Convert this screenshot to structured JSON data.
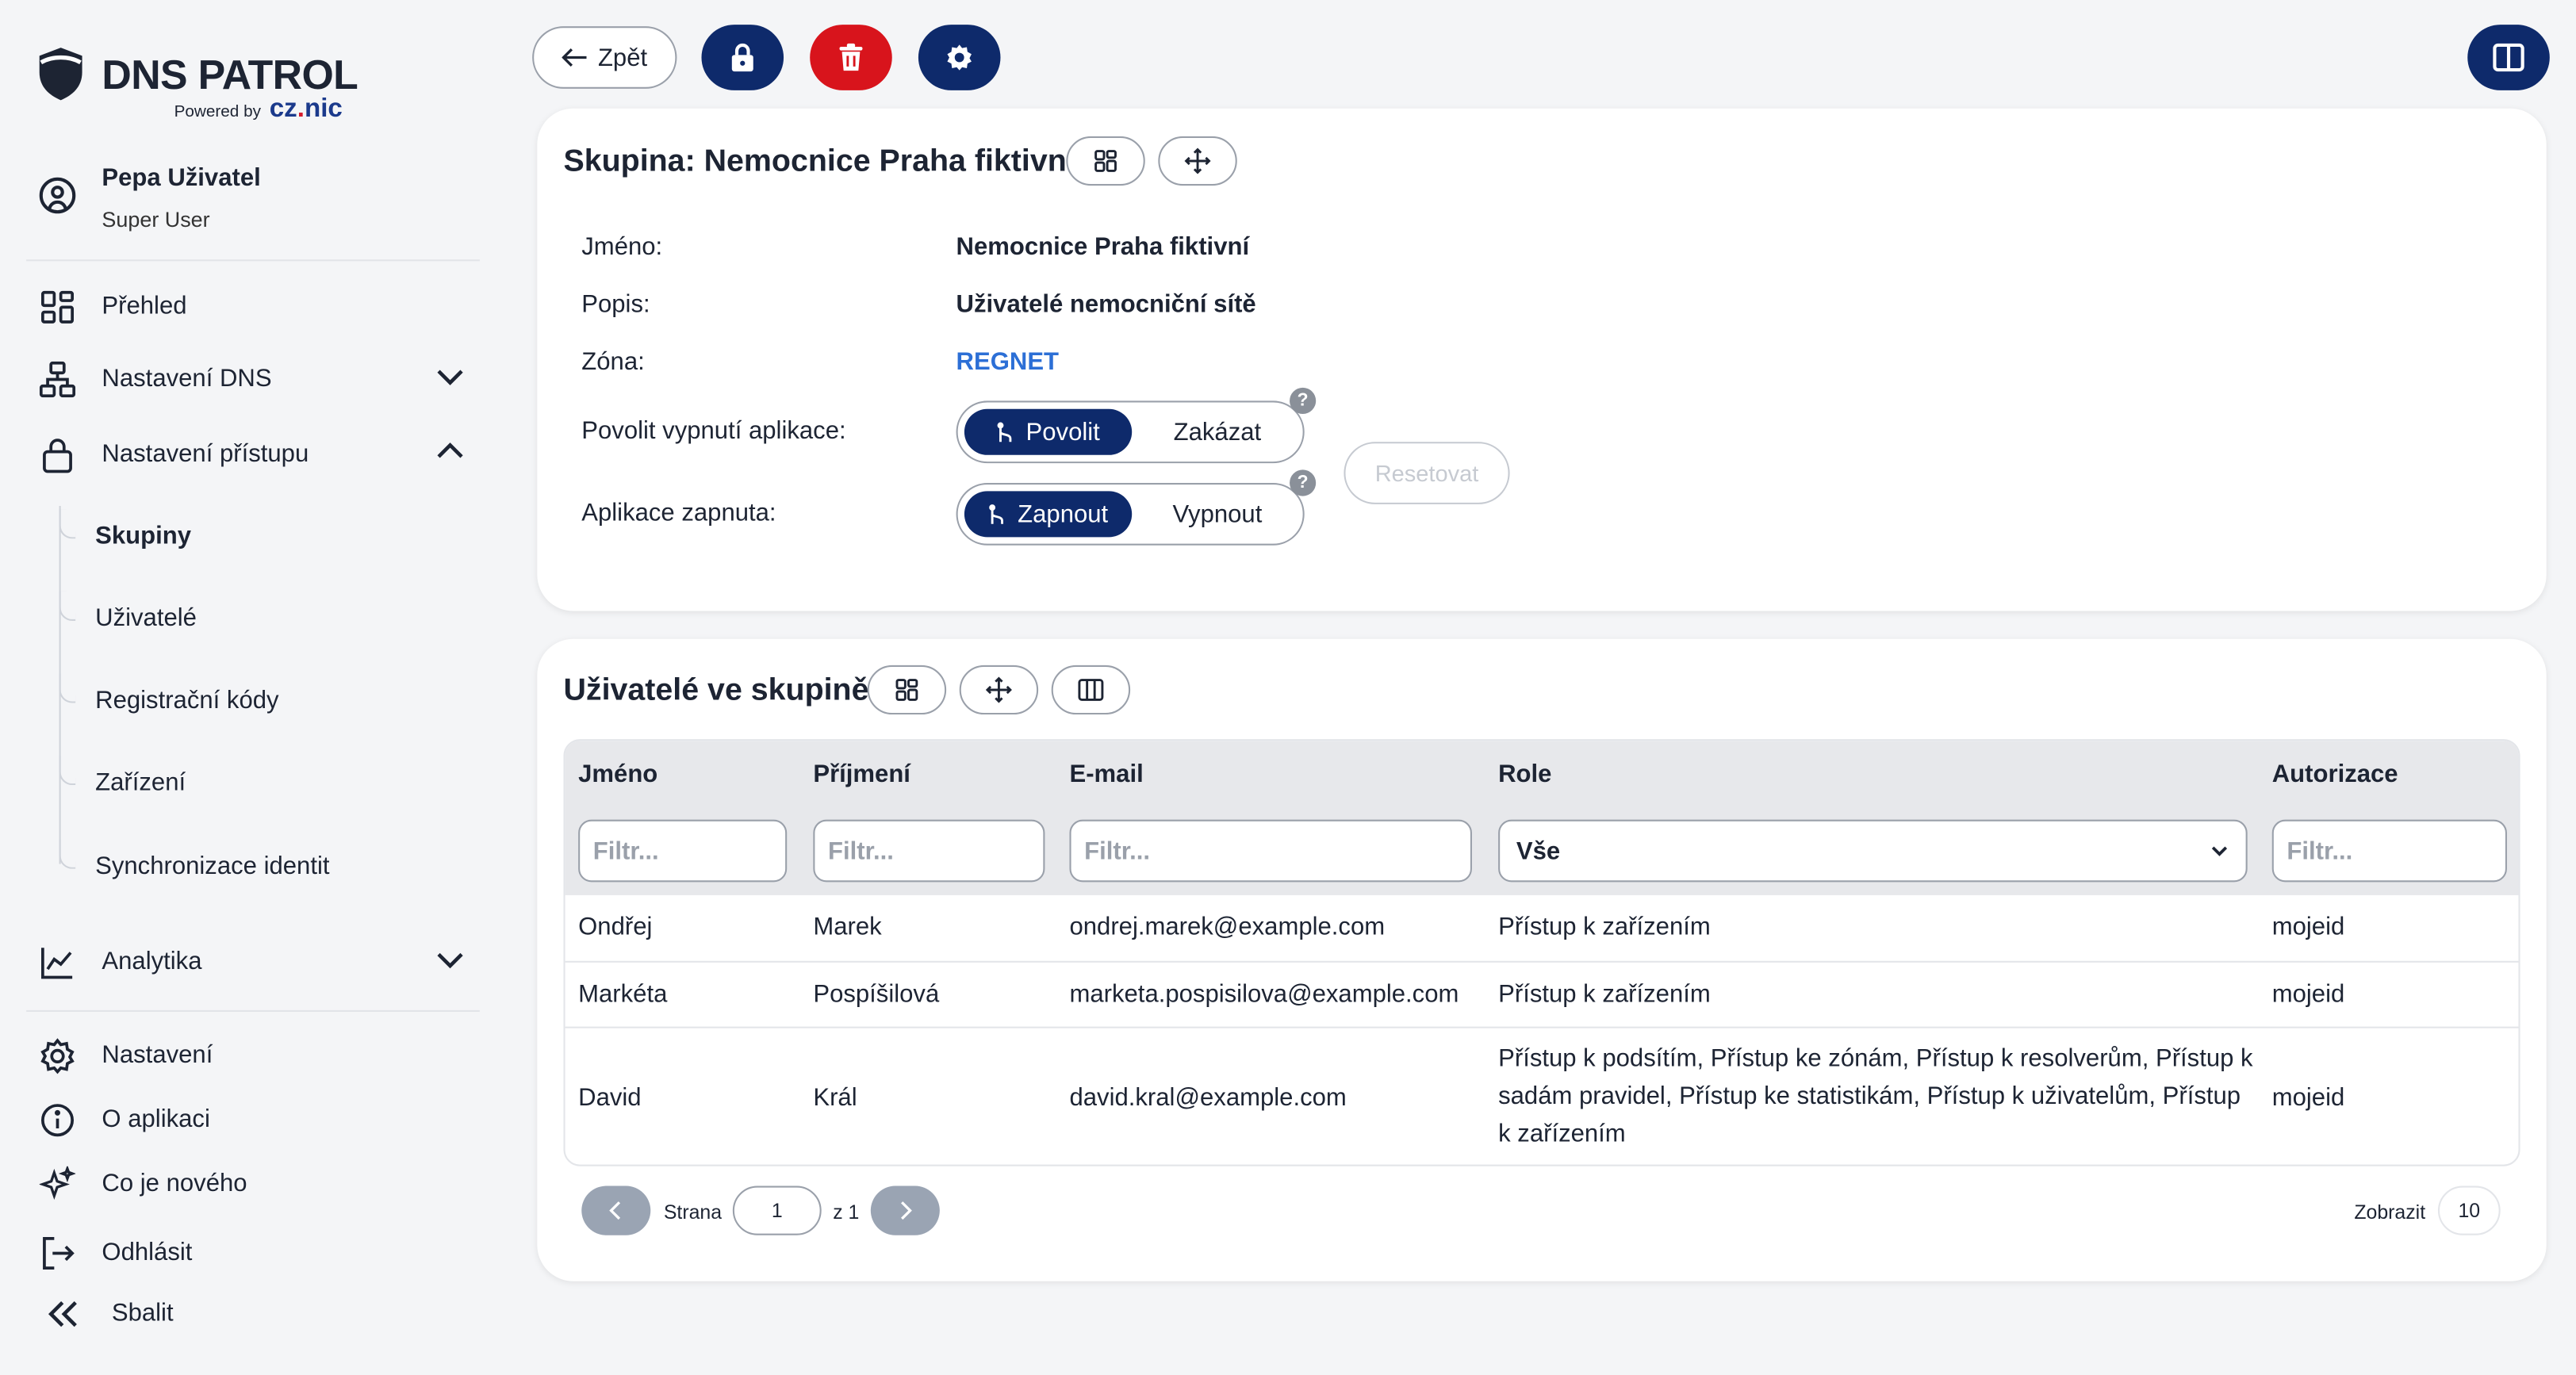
{
  "brand": {
    "name": "DNS PATROL",
    "powered_by": "Powered by",
    "partner": "cz",
    "partner_dot": ".",
    "partner_tail": "nic"
  },
  "user": {
    "name": "Pepa Uživatel",
    "role": "Super User"
  },
  "nav": {
    "overview": "Přehled",
    "dns_settings": "Nastavení DNS",
    "access_settings": "Nastavení přístupu",
    "sub": [
      "Skupiny",
      "Uživatelé",
      "Registrační kódy",
      "Zařízení",
      "Synchronizace identit"
    ],
    "analytics": "Analytika",
    "settings": "Nastavení",
    "about": "O aplikaci",
    "whats_new": "Co je nového",
    "logout": "Odhlásit",
    "collapse": "Sbalit"
  },
  "toolbar": {
    "back_label": "Zpět"
  },
  "group": {
    "title": "Skupina: Nemocnice Praha fiktivní",
    "labels": {
      "name": "Jméno:",
      "description": "Popis:",
      "zone": "Zóna:",
      "allow_disable": "Povolit vypnutí aplikace:",
      "app_enabled": "Aplikace zapnuta:"
    },
    "values": {
      "name": "Nemocnice Praha fiktivní",
      "description": "Uživatelé nemocniční sítě",
      "zone": "REGNET"
    },
    "allow_toggle": {
      "on": "Povolit",
      "off": "Zakázat"
    },
    "enabled_toggle": {
      "on": "Zapnout",
      "off": "Vypnout"
    },
    "help": "?",
    "reset_label": "Resetovat"
  },
  "members": {
    "title": "Uživatelé ve skupině",
    "columns": [
      "Jméno",
      "Příjmení",
      "E-mail",
      "Role",
      "Autorizace"
    ],
    "filter_placeholder": "Filtr...",
    "role_filter_value": "Vše",
    "rows": [
      {
        "first": "Ondřej",
        "last": "Marek",
        "email": "ondrej.marek@example.com",
        "role": "Přístup k zařízením",
        "auth": "mojeid"
      },
      {
        "first": "Markéta",
        "last": "Pospíšilová",
        "email": "marketa.pospisilova@example.com",
        "role": "Přístup k zařízením",
        "auth": "mojeid"
      },
      {
        "first": "David",
        "last": "Král",
        "email": "david.kral@example.com",
        "role": "Přístup k podsítím, Přístup ke zónám, Přístup k resolverům, Přístup k sadám pravidel, Přístup ke statistikám, Přístup k uživatelům, Přístup k zařízením",
        "auth": "mojeid"
      }
    ]
  },
  "pagination": {
    "page_label": "Strana",
    "page": "1",
    "of_label": "z 1",
    "show_label": "Zobrazit",
    "page_size": "10"
  },
  "colors": {
    "navy": "#0e2a6b",
    "danger": "#d8141c",
    "link": "#2c6fd6"
  }
}
